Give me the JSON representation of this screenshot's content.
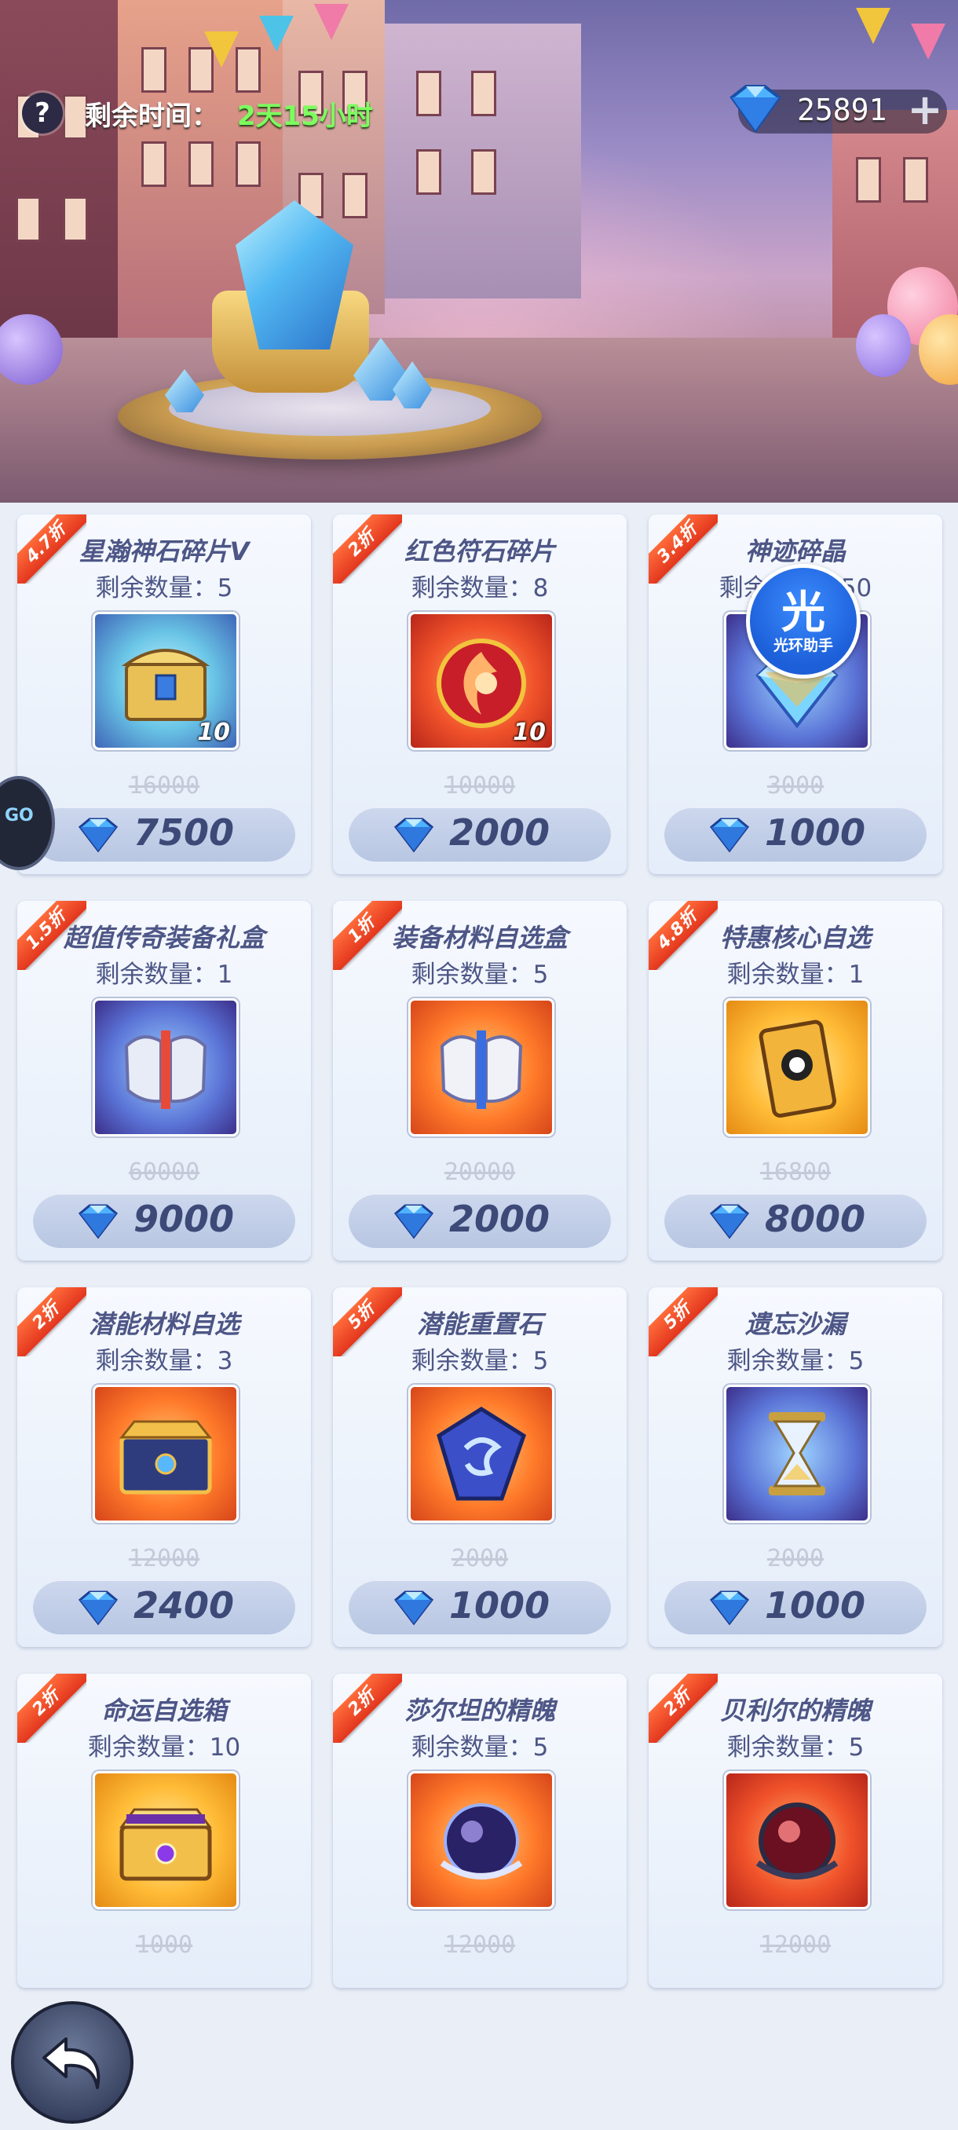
{
  "hud": {
    "help_glyph": "?",
    "time_label": "剩余时间：",
    "time_value": "2天15小时",
    "gem_balance": "25891",
    "plus_glyph": "+"
  },
  "helper": {
    "glyph": "光",
    "label": "光环助手"
  },
  "side_float": {
    "label": "GO"
  },
  "items": [
    {
      "discount": "4.7折",
      "name": "星瀚神石碎片V",
      "stock": "剩余数量：5",
      "qty": "10",
      "old_price": "16000",
      "price": "7500",
      "art": "chest-blue",
      "frame": "teal"
    },
    {
      "discount": "2折",
      "name": "红色符石碎片",
      "stock": "剩余数量：8",
      "qty": "10",
      "old_price": "10000",
      "price": "2000",
      "art": "rune-red",
      "frame": "red"
    },
    {
      "discount": "3.4折",
      "name": "神迹碎晶",
      "stock": "剩余数量：50",
      "qty": "",
      "old_price": "3000",
      "price": "1000",
      "art": "crystal-shard",
      "frame": "blue"
    },
    {
      "discount": "1.5折",
      "name": "超值传奇装备礼盒",
      "stock": "剩余数量：1",
      "qty": "",
      "old_price": "60000",
      "price": "9000",
      "art": "armor-blue",
      "frame": "blue"
    },
    {
      "discount": "1折",
      "name": "装备材料自选盒",
      "stock": "剩余数量：5",
      "qty": "",
      "old_price": "20000",
      "price": "2000",
      "art": "armor-orange",
      "frame": "orange"
    },
    {
      "discount": "4.8折",
      "name": "特惠核心自选",
      "stock": "剩余数量：1",
      "qty": "",
      "old_price": "16800",
      "price": "8000",
      "art": "core-card",
      "frame": "gold"
    },
    {
      "discount": "2折",
      "name": "潜能材料自选",
      "stock": "剩余数量：3",
      "qty": "",
      "old_price": "12000",
      "price": "2400",
      "art": "chest-orange",
      "frame": "orange"
    },
    {
      "discount": "5折",
      "name": "潜能重置石",
      "stock": "剩余数量：5",
      "qty": "",
      "old_price": "2000",
      "price": "1000",
      "art": "reset-stone",
      "frame": "orange"
    },
    {
      "discount": "5折",
      "name": "遗忘沙漏",
      "stock": "剩余数量：5",
      "qty": "",
      "old_price": "2000",
      "price": "1000",
      "art": "hourglass",
      "frame": "blue"
    },
    {
      "discount": "2折",
      "name": "命运自选箱",
      "stock": "剩余数量：10",
      "qty": "",
      "old_price": "1000",
      "price": "",
      "art": "chest-gold",
      "frame": "gold"
    },
    {
      "discount": "2折",
      "name": "莎尔坦的精魄",
      "stock": "剩余数量：5",
      "qty": "",
      "old_price": "12000",
      "price": "",
      "art": "orb-purple",
      "frame": "orange"
    },
    {
      "discount": "2折",
      "name": "贝利尔的精魄",
      "stock": "剩余数量：5",
      "qty": "",
      "old_price": "12000",
      "price": "",
      "art": "orb-red",
      "frame": "red"
    }
  ],
  "colors": {
    "accent_green": "#7cff5e",
    "ribbon_red": "#e2361e",
    "card_text": "#4d5686"
  }
}
